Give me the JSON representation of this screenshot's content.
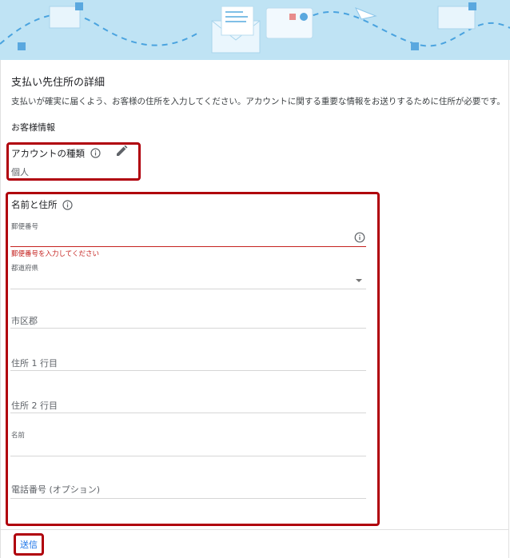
{
  "page": {
    "title": "支払い先住所の詳細",
    "description": "支払いが確実に届くよう、お客様の住所を入力してください。アカウントに関する重要な情報をお送りするために住所が必要です。",
    "customer_section": "お客様情報"
  },
  "account_type": {
    "label": "アカウントの種類",
    "value": "個人",
    "info_icon": "info-icon",
    "edit_icon": "pencil-icon"
  },
  "address": {
    "label": "名前と住所",
    "info_icon": "info-icon",
    "postal_code": {
      "label": "郵便番号",
      "value": "",
      "error": "郵便番号を入力してください"
    },
    "prefecture": {
      "label": "都道府県",
      "value": ""
    },
    "city": {
      "placeholder": "市区郡"
    },
    "address_line1": {
      "placeholder": "住所 1 行目"
    },
    "address_line2": {
      "placeholder": "住所 2 行目"
    },
    "name": {
      "label": "名前",
      "value": ""
    },
    "phone": {
      "placeholder": "電話番号 (オプション)"
    }
  },
  "actions": {
    "submit_label": "送信"
  },
  "colors": {
    "banner_bg": "#bfe3f4",
    "highlight": "#b0000c",
    "error": "#c5221f",
    "link": "#1a73e8"
  }
}
